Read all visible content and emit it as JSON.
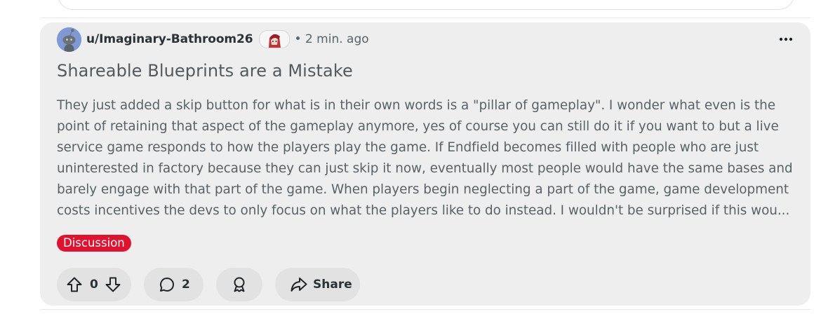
{
  "post": {
    "username": "u/Imaginary-Bathroom26",
    "separator": "•",
    "time": "2 min. ago",
    "title": "Shareable Blueprints are a Mistake",
    "body_lines": [
      "They just added a skip button for what is in their own words is a \"pillar of gameplay\". I wonder what even is the",
      "point of retaining that aspect of the gameplay anymore, yes of course you can still do it if you want to but a live",
      "service game responds to how the players play the game. If Endfield becomes filled with people who are just",
      "uninterested in factory because they can just skip it now, eventually most people would have the same bases and",
      "barely engage with that part of the game. When players begin neglecting a part of the game, game development",
      "costs incentives the devs to only focus on what the players like to do instead. I wouldn't be surprised if this wou..."
    ],
    "flair": "Discussion",
    "vote_count": "0",
    "comment_count": "2",
    "share_label": "Share"
  },
  "icons": {
    "avatar": "snoo-avatar-icon",
    "flair_avatar": "character-flair-icon",
    "more": "more-options-icon",
    "upvote": "upvote-arrow-icon",
    "downvote": "downvote-arrow-icon",
    "comment": "comment-bubble-icon",
    "award": "award-ribbon-icon",
    "share": "share-arrow-icon"
  },
  "colors": {
    "flair_bg": "#e2112e",
    "card_bg": "#eeeeee",
    "button_bg": "#e2e2e2",
    "avatar_bg": "#7e99d8"
  }
}
